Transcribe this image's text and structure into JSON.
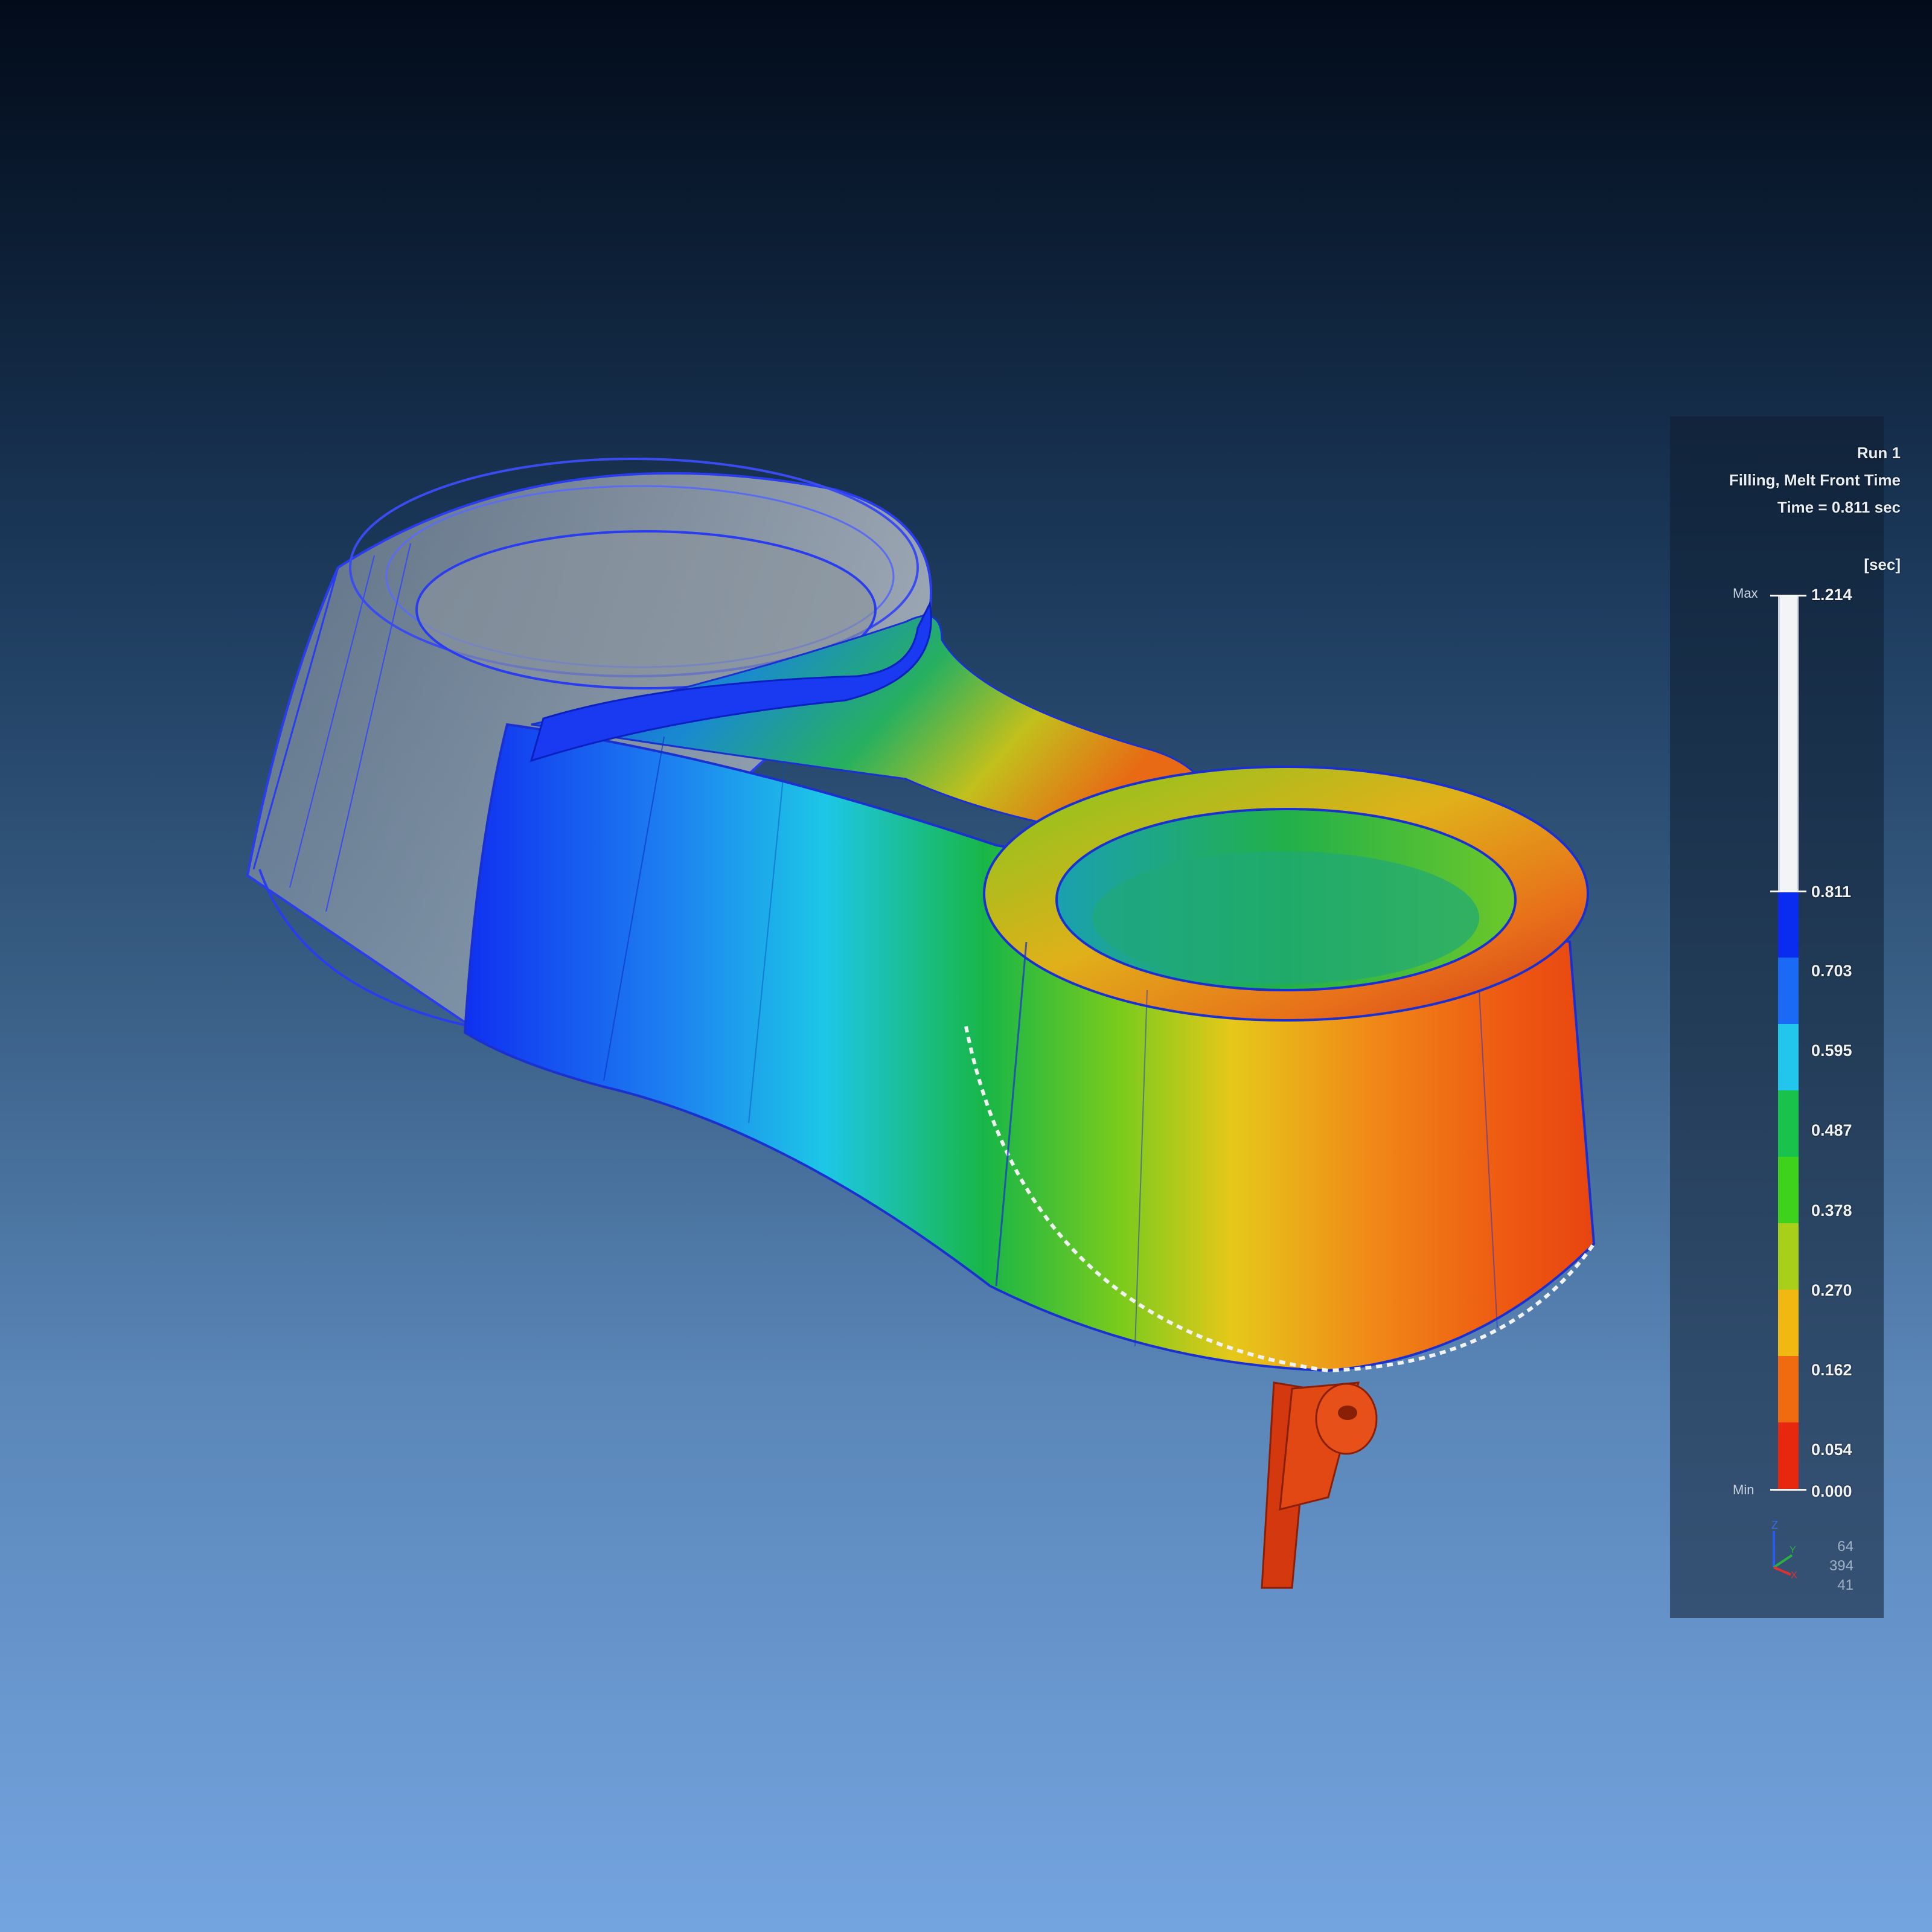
{
  "legend": {
    "run": "Run 1",
    "result": "Filling, Melt Front Time",
    "time": "Time = 0.811 sec",
    "unit": "[sec]",
    "max_label": "Max",
    "min_label": "Min",
    "max_value": "1.214",
    "min_value": "0.000",
    "ticks": [
      "0.811",
      "0.703",
      "0.595",
      "0.487",
      "0.378",
      "0.270",
      "0.162",
      "0.054"
    ],
    "colors": [
      "#0a2cf0",
      "#1a6af5",
      "#22c6ec",
      "#19c24a",
      "#3fd21c",
      "#a8d01a",
      "#f2b812",
      "#f06a10",
      "#e8280e"
    ]
  },
  "triad": {
    "axis_z": "Z",
    "axis_y": "Y",
    "axis_x": "X",
    "numbers": [
      "64",
      "394",
      "41"
    ]
  },
  "scene": {
    "part": "Molded bracket with two circular bosses",
    "gate": "Sprue and runner"
  }
}
